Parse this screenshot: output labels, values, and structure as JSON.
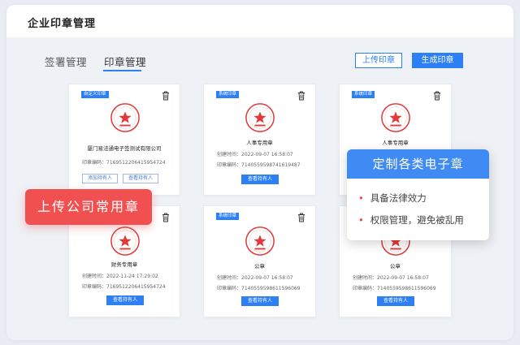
{
  "app": {
    "title": "企业印章管理"
  },
  "tabs": [
    {
      "label": "签署管理",
      "active": false
    },
    {
      "label": "印章管理",
      "active": true
    }
  ],
  "toolbar": {
    "upload_label": "上传印章",
    "generate_label": "生成印章"
  },
  "cards": [
    {
      "tag": "自定义印章",
      "name": "厦门易法通电子签测试有限公司",
      "code_label": "印章编码：7169512206415954724",
      "buttons": [
        "添加持有人",
        "查看持有人"
      ]
    },
    {
      "tag": "系统印章",
      "name": "人事专用章",
      "created": "创建时间：2022-09-07 16:58:07",
      "code_label": "印章编码：7140559598741619487",
      "button": "查看持有人"
    },
    {
      "tag": "系统印章",
      "name": "人事专用章"
    },
    {
      "name": "财务专用章",
      "created": "创建时间：2022-11-24 17:29:02",
      "code_label": "印章编码：7169512206415954724",
      "button": "查看持有人"
    },
    {
      "tag": "系统印章",
      "name": "公章",
      "created": "创建时间：2022-09-07 16:58:07",
      "code_label": "印章编码：7140559598611596069",
      "button": "查看持有人"
    },
    {
      "name": "公章",
      "created": "创建时间：2022-09-07 16:58:07",
      "code_label": "印章编码：7140559598611596069",
      "button": "查看持有人"
    }
  ],
  "banner": {
    "text": "上传公司常用章"
  },
  "popup": {
    "title": "定制各类电子章",
    "items": [
      "具备法律效力",
      "权限管理，避免被乱用"
    ]
  },
  "colors": {
    "accent": "#2d7ff5",
    "seal_red": "#e23a3a",
    "banner_red": "#f05050"
  }
}
